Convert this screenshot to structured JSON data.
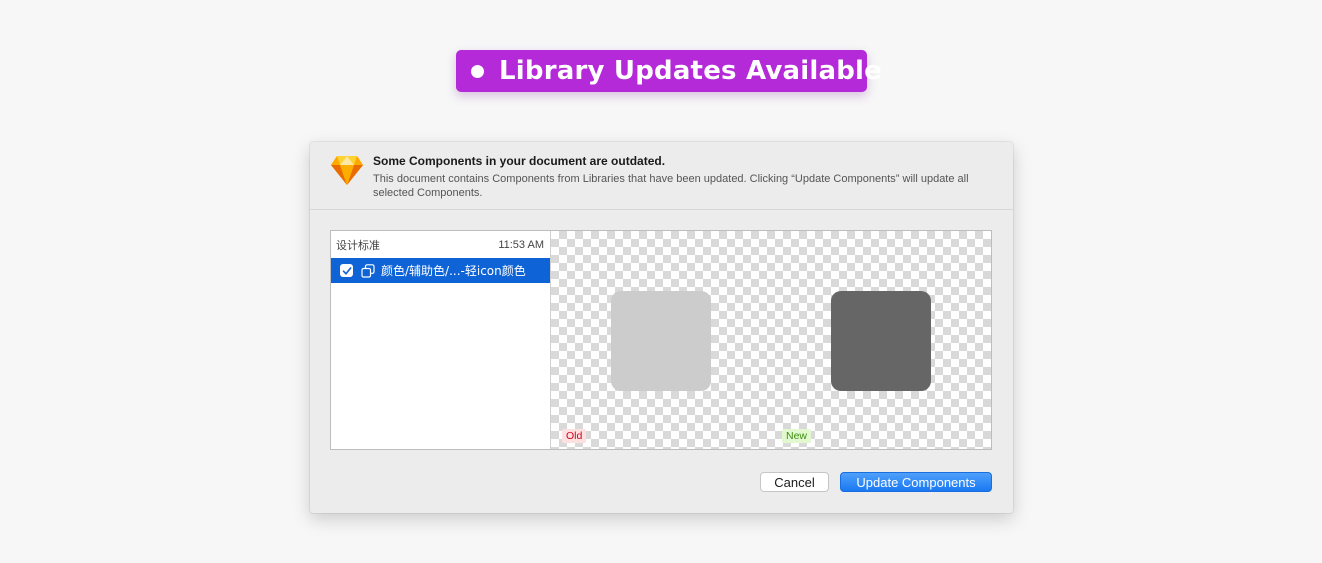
{
  "badge": {
    "label": "Library Updates Available",
    "color": "#b42ad8"
  },
  "dialog": {
    "app_icon": "sketch-diamond-icon",
    "title": "Some Components in your document are outdated.",
    "description": "This document contains Components from Libraries that have been updated. Clicking “Update Components” will update all selected Components.",
    "list": {
      "library_name": "设计标准",
      "time": "11:53 AM",
      "items": [
        {
          "checked": true,
          "icon": "component-icon",
          "label": "颜色/辅助色/...-轻icon颜色"
        }
      ]
    },
    "preview": {
      "old_label": "Old",
      "new_label": "New",
      "old_color": "#cccccc",
      "new_color": "#666666"
    },
    "buttons": {
      "cancel_label": "Cancel",
      "update_label": "Update Components"
    }
  }
}
